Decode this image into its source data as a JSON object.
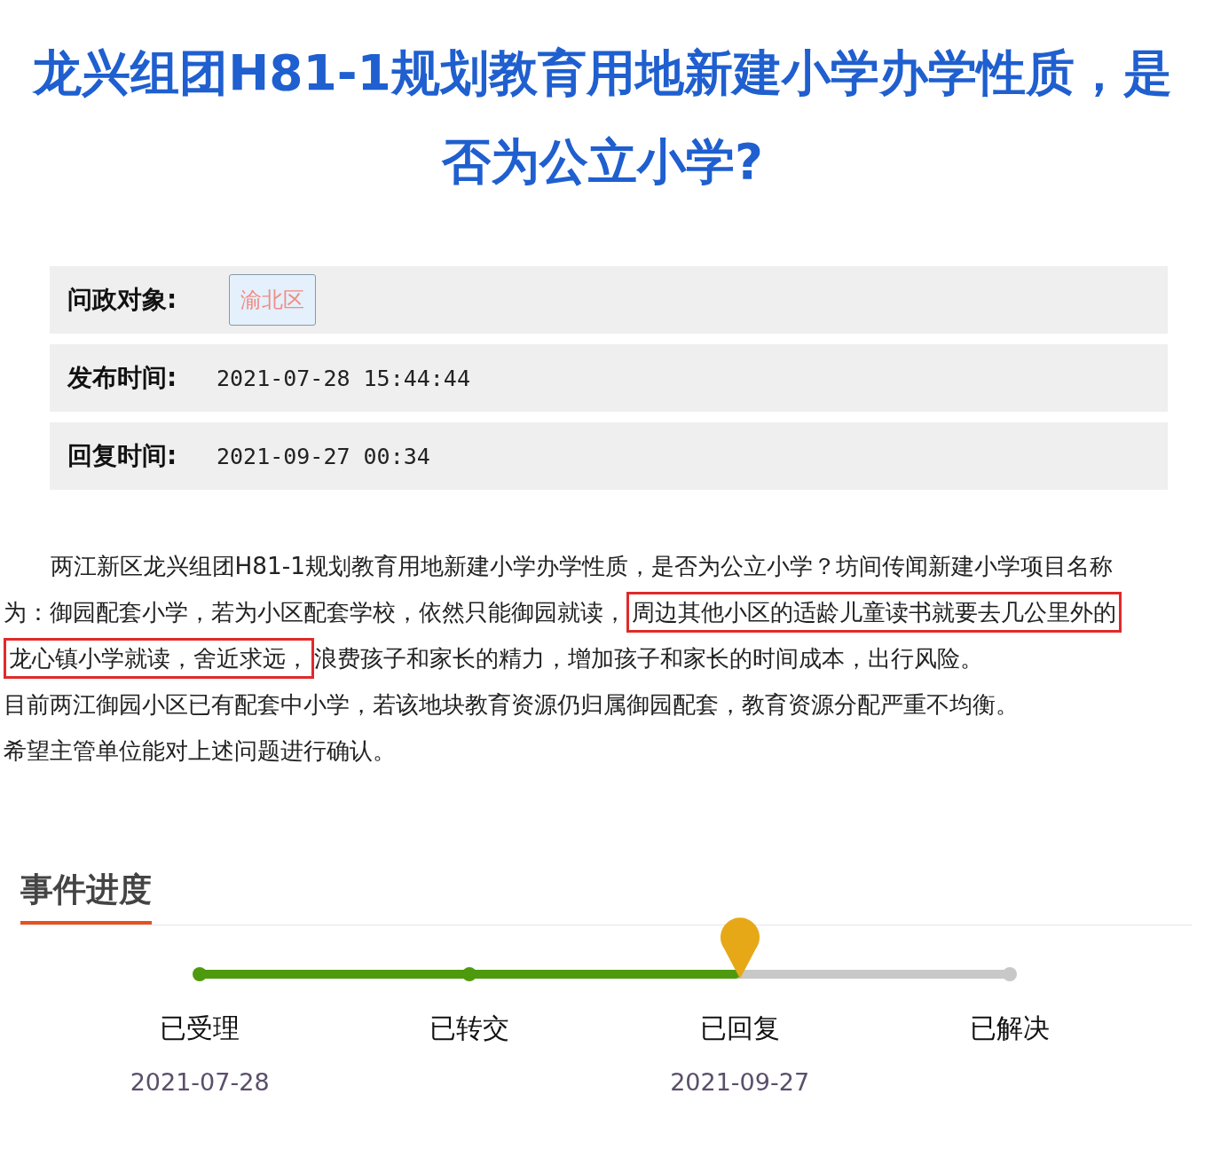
{
  "title": "龙兴组团H81-1规划教育用地新建小学办学性质，是否为公立小学?",
  "info": [
    {
      "kind": "tag",
      "label": "问政对象:",
      "value": "渝北区"
    },
    {
      "kind": "text",
      "label": "发布时间:",
      "value": "2021-07-28 15:44:44"
    },
    {
      "kind": "text",
      "label": "回复时间:",
      "value": "2021-09-27 00:34"
    }
  ],
  "body": {
    "paragraphs": [
      {
        "indent": true,
        "segments": [
          {
            "text": "两江新区龙兴组团H81-1规划教育用地新建小学办学性质，是否为公立小学？坊间传闻新建小学项目名称",
            "highlighted": false
          }
        ]
      },
      {
        "indent": false,
        "segments": [
          {
            "text": "为：御园配套小学，若为小区配套学校，依然只能御园就读，",
            "highlighted": false
          },
          {
            "text": "周边其他小区的适龄儿童读书就要去几公里外的",
            "highlighted": true
          }
        ]
      },
      {
        "indent": false,
        "segments": [
          {
            "text": "龙心镇小学就读，舍近求远，",
            "highlighted": true
          },
          {
            "text": "浪费孩子和家长的精力，增加孩子和家长的时间成本，出行风险。",
            "highlighted": false
          }
        ]
      },
      {
        "indent": false,
        "segments": [
          {
            "text": "目前两江御园小区已有配套中小学，若该地块教育资源仍归属御园配套，教育资源分配严重不均衡。",
            "highlighted": false
          }
        ]
      },
      {
        "indent": false,
        "segments": [
          {
            "text": "希望主管单位能对上述问题进行确认。",
            "highlighted": false
          }
        ]
      }
    ]
  },
  "progress": {
    "heading": "事件进度",
    "level": 0.667,
    "steps": [
      {
        "label": "已受理",
        "date": "2021-07-28",
        "kind": "done"
      },
      {
        "label": "已转交",
        "kind": "done"
      },
      {
        "label": "已回复",
        "date": "2021-09-27",
        "kind": "current"
      },
      {
        "label": "已解决",
        "kind": "pending"
      }
    ]
  }
}
